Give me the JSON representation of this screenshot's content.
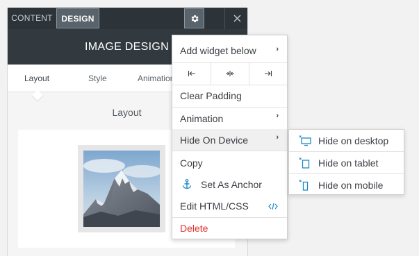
{
  "colors": {
    "accent": "#1e88c7",
    "danger": "#e0312f",
    "dark_bar": "#2c3339"
  },
  "panel": {
    "tabs": {
      "content": "CONTENT",
      "design": "DESIGN"
    },
    "title": "IMAGE DESIGN",
    "subtabs": [
      "Layout",
      "Style",
      "Animation"
    ],
    "section_label": "Layout",
    "icons": {
      "settings": "gear-icon",
      "close": "close-icon"
    }
  },
  "menu": {
    "add_widget": "Add widget below",
    "align_icons": [
      "|←",
      "→|←",
      "→|"
    ],
    "clear_padding": "Clear Padding",
    "animation": "Animation",
    "hide_on_device": "Hide On Device",
    "copy": "Copy",
    "set_as_anchor": "Set As Anchor",
    "edit_html": "Edit HTML/CSS",
    "delete": "Delete",
    "arrow": "›"
  },
  "submenu": {
    "items": [
      "Hide on desktop",
      "Hide on tablet",
      "Hide on mobile"
    ]
  }
}
